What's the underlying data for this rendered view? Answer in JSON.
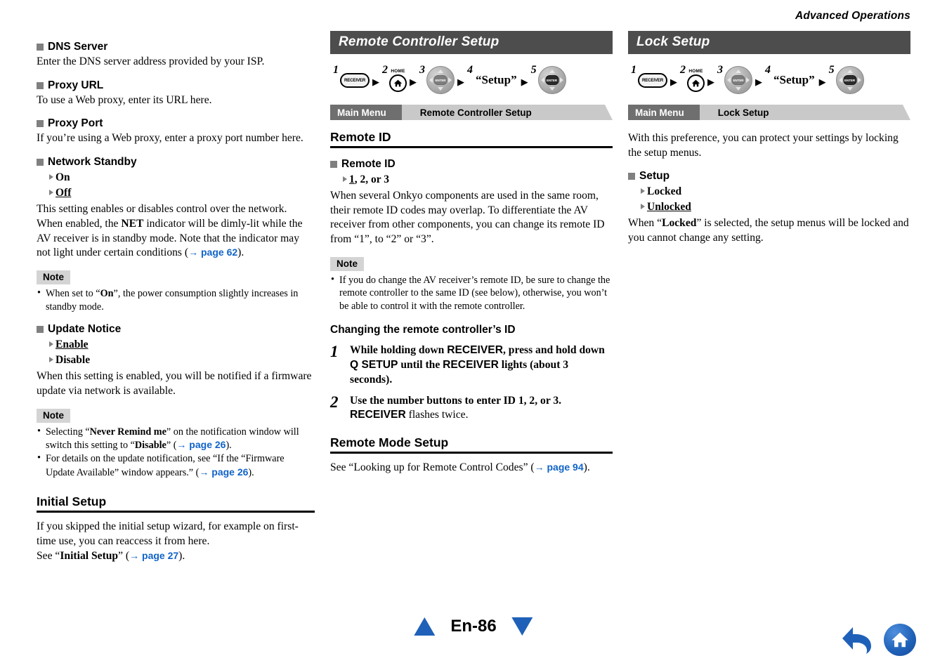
{
  "header": {
    "running_title": "Advanced Operations"
  },
  "footer": {
    "page_label": "En-86",
    "prev_icon": "triangle-up-icon",
    "next_icon": "triangle-down-icon",
    "back_icon": "back-arrow-icon",
    "home_icon": "home-icon"
  },
  "left_column": {
    "sections": [
      {
        "heading": "DNS Server",
        "body": "Enter the DNS server address provided by your ISP."
      },
      {
        "heading": "Proxy URL",
        "body": "To use a Web proxy, enter its URL here."
      },
      {
        "heading": "Proxy Port",
        "body": "If you’re using a Web proxy, enter a proxy port number here."
      }
    ],
    "network_standby": {
      "heading": "Network Standby",
      "options": [
        {
          "label": "On",
          "default": false
        },
        {
          "label": "Off",
          "default": true
        }
      ],
      "body_part1": "This setting enables or disables control over the network. When enabled, the ",
      "body_bold1": "NET",
      "body_part2": " indicator will be dimly-lit while the AV receiver is in standby mode. Note that the indicator may not light under certain conditions (",
      "ref": "→ page 62",
      "body_part3": ").",
      "note_label": "Note",
      "note_part1": "When set to “",
      "note_bold1": "On",
      "note_part2": "”, the power consumption slightly increases in standby mode."
    },
    "update_notice": {
      "heading": "Update Notice",
      "options": [
        {
          "label": "Enable",
          "default": true
        },
        {
          "label": "Disable",
          "default": false
        }
      ],
      "body": "When this setting is enabled, you will be notified if a firmware update via network is available.",
      "note_label": "Note",
      "notes": [
        {
          "part1": "Selecting “",
          "bold1": "Never Remind me",
          "part2": "” on the notification window will switch this setting to “",
          "bold2": "Disable",
          "part3": "” (",
          "ref": "→ page 26",
          "part4": ")."
        },
        {
          "part1": "For details on the update notification, see “If the “Firmware Update Available” window appears.” (",
          "ref": "→ page 26",
          "part4": ")."
        }
      ]
    },
    "initial_setup": {
      "heading": "Initial Setup",
      "body1": "If you skipped the initial setup wizard, for example on first-time use, you can reaccess it from here.",
      "body2_part1": "See “",
      "body2_bold": "Initial Setup",
      "body2_part2": "” (",
      "ref": "→ page 27",
      "body2_part3": ")."
    }
  },
  "middle_column": {
    "banner": "Remote Controller Setup",
    "steps": [
      {
        "num": "1",
        "type": "receiver-button",
        "label": "RECEIVER"
      },
      {
        "num": "2",
        "type": "home-button",
        "label": "HOME"
      },
      {
        "num": "3",
        "type": "navpad",
        "label": "ENTER"
      },
      {
        "num": "4",
        "type": "quote",
        "label": "“Setup”"
      },
      {
        "num": "5",
        "type": "navpad-enter",
        "label": "ENTER"
      }
    ],
    "breadcrumb": {
      "first": "Main Menu",
      "second": "Remote Controller Setup"
    },
    "remote_id_heading": "Remote ID",
    "remote_id": {
      "heading": "Remote ID",
      "option_pre": "1",
      "option_post": ", 2, or 3",
      "body": "When several Onkyo components are used in the same room, their remote ID codes may overlap. To differentiate the AV receiver from other components, you can change its remote ID from “1”, to “2” or “3”.",
      "note_label": "Note",
      "note": "If you do change the AV receiver’s remote ID, be sure to change the remote controller to the same ID (see below), otherwise, you won’t be able to control it with the remote controller."
    },
    "changing_id": {
      "heading": "Changing the remote controller’s ID",
      "steps": [
        {
          "num": "1",
          "part1": "While holding down ",
          "sans1": "RECEIVER",
          "part2": ", press and hold down ",
          "sans2": "Q SETUP",
          "part3": " until the ",
          "sans3": "RECEIVER",
          "part4": " lights (about 3 seconds)."
        },
        {
          "num": "2",
          "part1": "Use the number buttons to enter ID 1, 2, or 3. ",
          "sans1": "RECEIVER",
          "part2_regular": " flashes twice."
        }
      ]
    },
    "remote_mode": {
      "heading": "Remote Mode Setup",
      "body_part1": "See “Looking up for Remote Control Codes” (",
      "ref": "→ page 94",
      "body_part2": ")."
    }
  },
  "right_column": {
    "banner": "Lock Setup",
    "steps": [
      {
        "num": "1",
        "type": "receiver-button",
        "label": "RECEIVER"
      },
      {
        "num": "2",
        "type": "home-button",
        "label": "HOME"
      },
      {
        "num": "3",
        "type": "navpad",
        "label": "ENTER"
      },
      {
        "num": "4",
        "type": "quote",
        "label": "“Setup”"
      },
      {
        "num": "5",
        "type": "navpad-enter",
        "label": "ENTER"
      }
    ],
    "breadcrumb": {
      "first": "Main Menu",
      "second": "Lock Setup"
    },
    "intro": "With this preference, you can protect your settings by locking the setup menus.",
    "setup": {
      "heading": "Setup",
      "options": [
        {
          "label": "Locked",
          "default": false
        },
        {
          "label": "Unlocked",
          "default": true
        }
      ],
      "body_part1": "When “",
      "body_bold": "Locked",
      "body_part2": "” is selected, the setup menus will be locked and you cannot change any setting."
    }
  },
  "colors": {
    "banner_bg": "#4d4d4d",
    "breadcrumb_first": "#6f6f6f",
    "breadcrumb_second": "#c9c9c9",
    "note_bg": "#d4d4d4",
    "marker_gray": "#808080",
    "link_blue": "#1163c8",
    "footer_blue": "#1f61b8"
  }
}
